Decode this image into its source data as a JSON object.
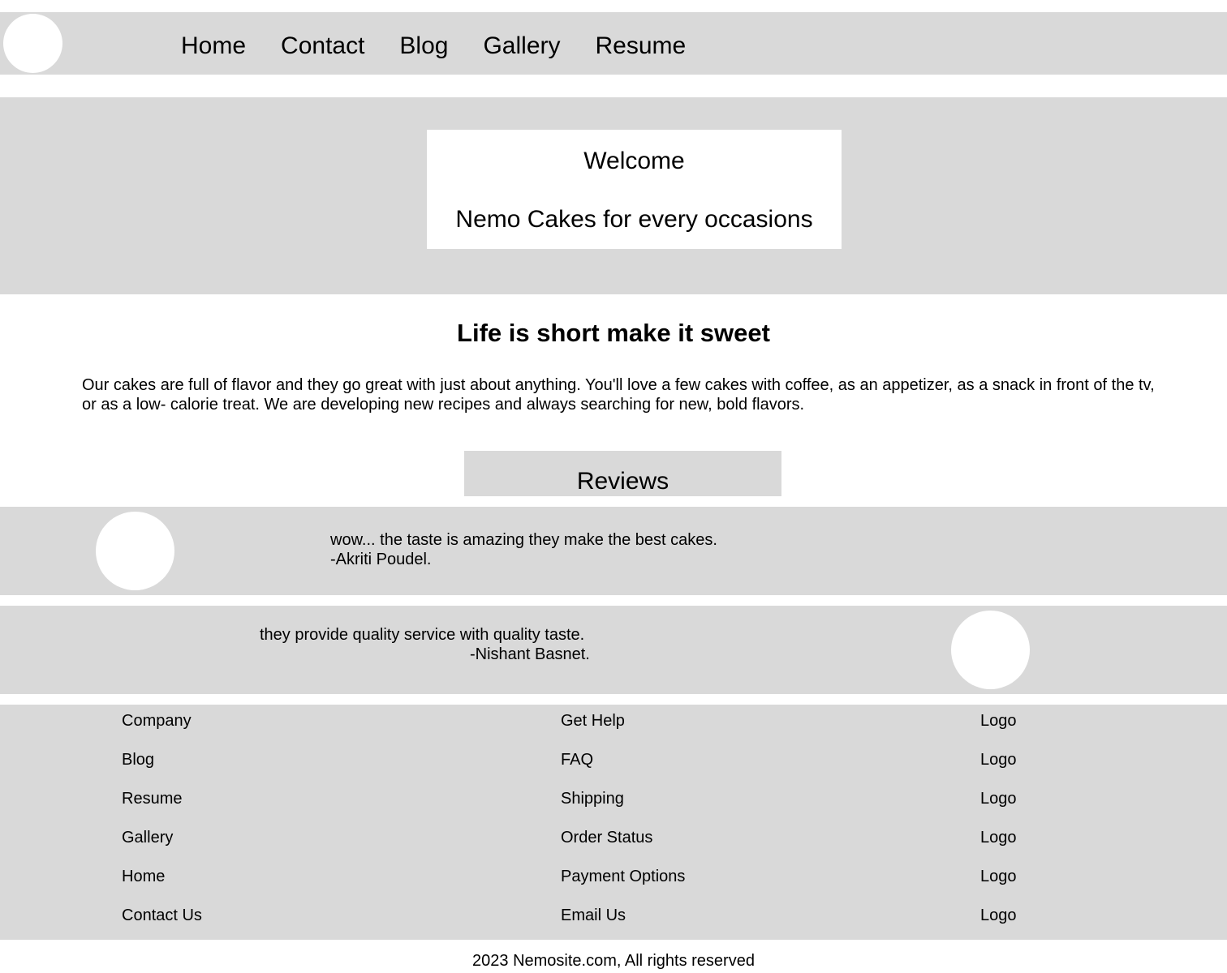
{
  "header": {
    "nav": [
      "Home",
      "Contact",
      "Blog",
      "Gallery",
      "Resume"
    ]
  },
  "hero": {
    "welcome": "Welcome",
    "tagline": "Nemo Cakes for every occasions"
  },
  "intro": {
    "title": "Life is short make it sweet",
    "text": "Our cakes are full of flavor and they go great with just about anything. You'll love a few cakes with coffee, as an appetizer, as a snack in front of the tv, or as a low- calorie treat. We are developing new recipes and always searching for new, bold flavors."
  },
  "reviews": {
    "heading": "Reviews",
    "items": [
      {
        "quote": "wow... the taste is amazing they make the best cakes.",
        "author": "-Akriti Poudel."
      },
      {
        "quote": "they provide quality service with quality taste.",
        "author": "-Nishant Basnet."
      }
    ]
  },
  "footer": {
    "col1": [
      "Company",
      "Blog",
      "Resume",
      "Gallery",
      "Home",
      "Contact Us"
    ],
    "col2": [
      "Get Help",
      "FAQ",
      "Shipping",
      "Order Status",
      "Payment Options",
      "Email Us"
    ],
    "col3": [
      "Logo",
      "Logo",
      "Logo",
      "Logo",
      "Logo",
      "Logo"
    ],
    "copyright": "2023 Nemosite.com, All rights reserved"
  }
}
